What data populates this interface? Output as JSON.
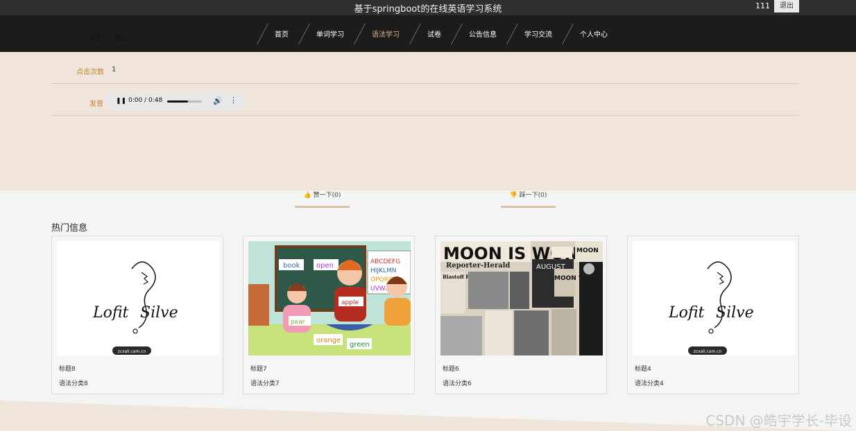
{
  "system": {
    "title": "基于springboot的在线英语学习系统",
    "username": "111",
    "logout_label": "退出"
  },
  "breadcrumb": [
    "语法",
    "测试"
  ],
  "nav": [
    {
      "label": "首页"
    },
    {
      "label": "单词学习"
    },
    {
      "label": "语法学习",
      "active": true
    },
    {
      "label": "试卷"
    },
    {
      "label": "公告信息"
    },
    {
      "label": "学习交流"
    },
    {
      "label": "个人中心"
    }
  ],
  "detail": {
    "clicks_label": "点击次数",
    "clicks_value": "1",
    "audio_label": "发音",
    "audio_time": "0:00 / 0:48",
    "audio_progress": 0.6
  },
  "votes": {
    "up_label": "赞一下(0)",
    "down_label": "踩一下(0)"
  },
  "hot": {
    "title": "热门信息",
    "cards": [
      {
        "title": "标题8",
        "category": "语法分类8",
        "image": "lofit-silve-logo",
        "badge": "zcxali.cam.cn"
      },
      {
        "title": "标题7",
        "category": "语法分类7",
        "image": "kids-classroom-illustration",
        "words": [
          "book",
          "open",
          "apple",
          "pear",
          "orange",
          "green",
          "ABCDEFG",
          "HIJKLMN",
          "OPQRST",
          "UVWXYZ"
        ]
      },
      {
        "title": "标题6",
        "category": "语法分类6",
        "image": "newspaper-collage",
        "words": [
          "MOON IS WON",
          "Reporter-Herald",
          "AUGUST",
          "MOON",
          "Blastoff Perfect",
          "MOON WA"
        ]
      },
      {
        "title": "标题4",
        "category": "语法分类4",
        "image": "lofit-silve-logo",
        "badge": "zcxali.cam.cn"
      }
    ]
  },
  "watermark": "CSDN @皓宇学长-毕设",
  "colors": {
    "accent": "#c5822e",
    "nav_active": "#d7b48f",
    "beige": "#efe5db",
    "navbar": "#1c1c1c"
  }
}
